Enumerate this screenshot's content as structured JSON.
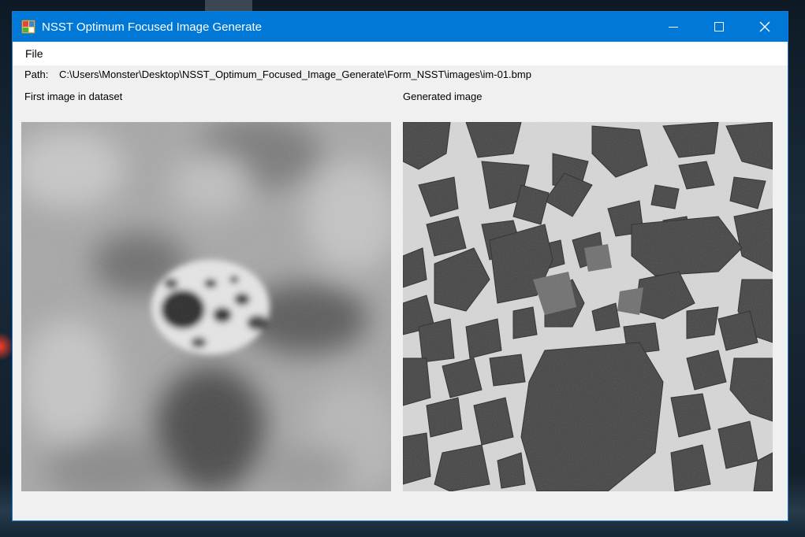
{
  "window": {
    "title": "NSST Optimum Focused Image Generate",
    "icon": "app-icon",
    "controls": [
      "minimize-icon",
      "maximize-icon",
      "close-icon"
    ]
  },
  "menu": {
    "items": [
      "File"
    ]
  },
  "path": {
    "label": "Path:",
    "value": "C:\\Users\\Monster\\Desktop\\NSST_Optimum_Focused_Image_Generate\\Form_NSST\\images\\im-01.bmp"
  },
  "panels": {
    "left_label": "First image in dataset",
    "right_label": "Generated image"
  },
  "colors": {
    "titlebar": "#0078d7",
    "form_background": "#f0f0f0",
    "menubar": "#ffffff"
  }
}
